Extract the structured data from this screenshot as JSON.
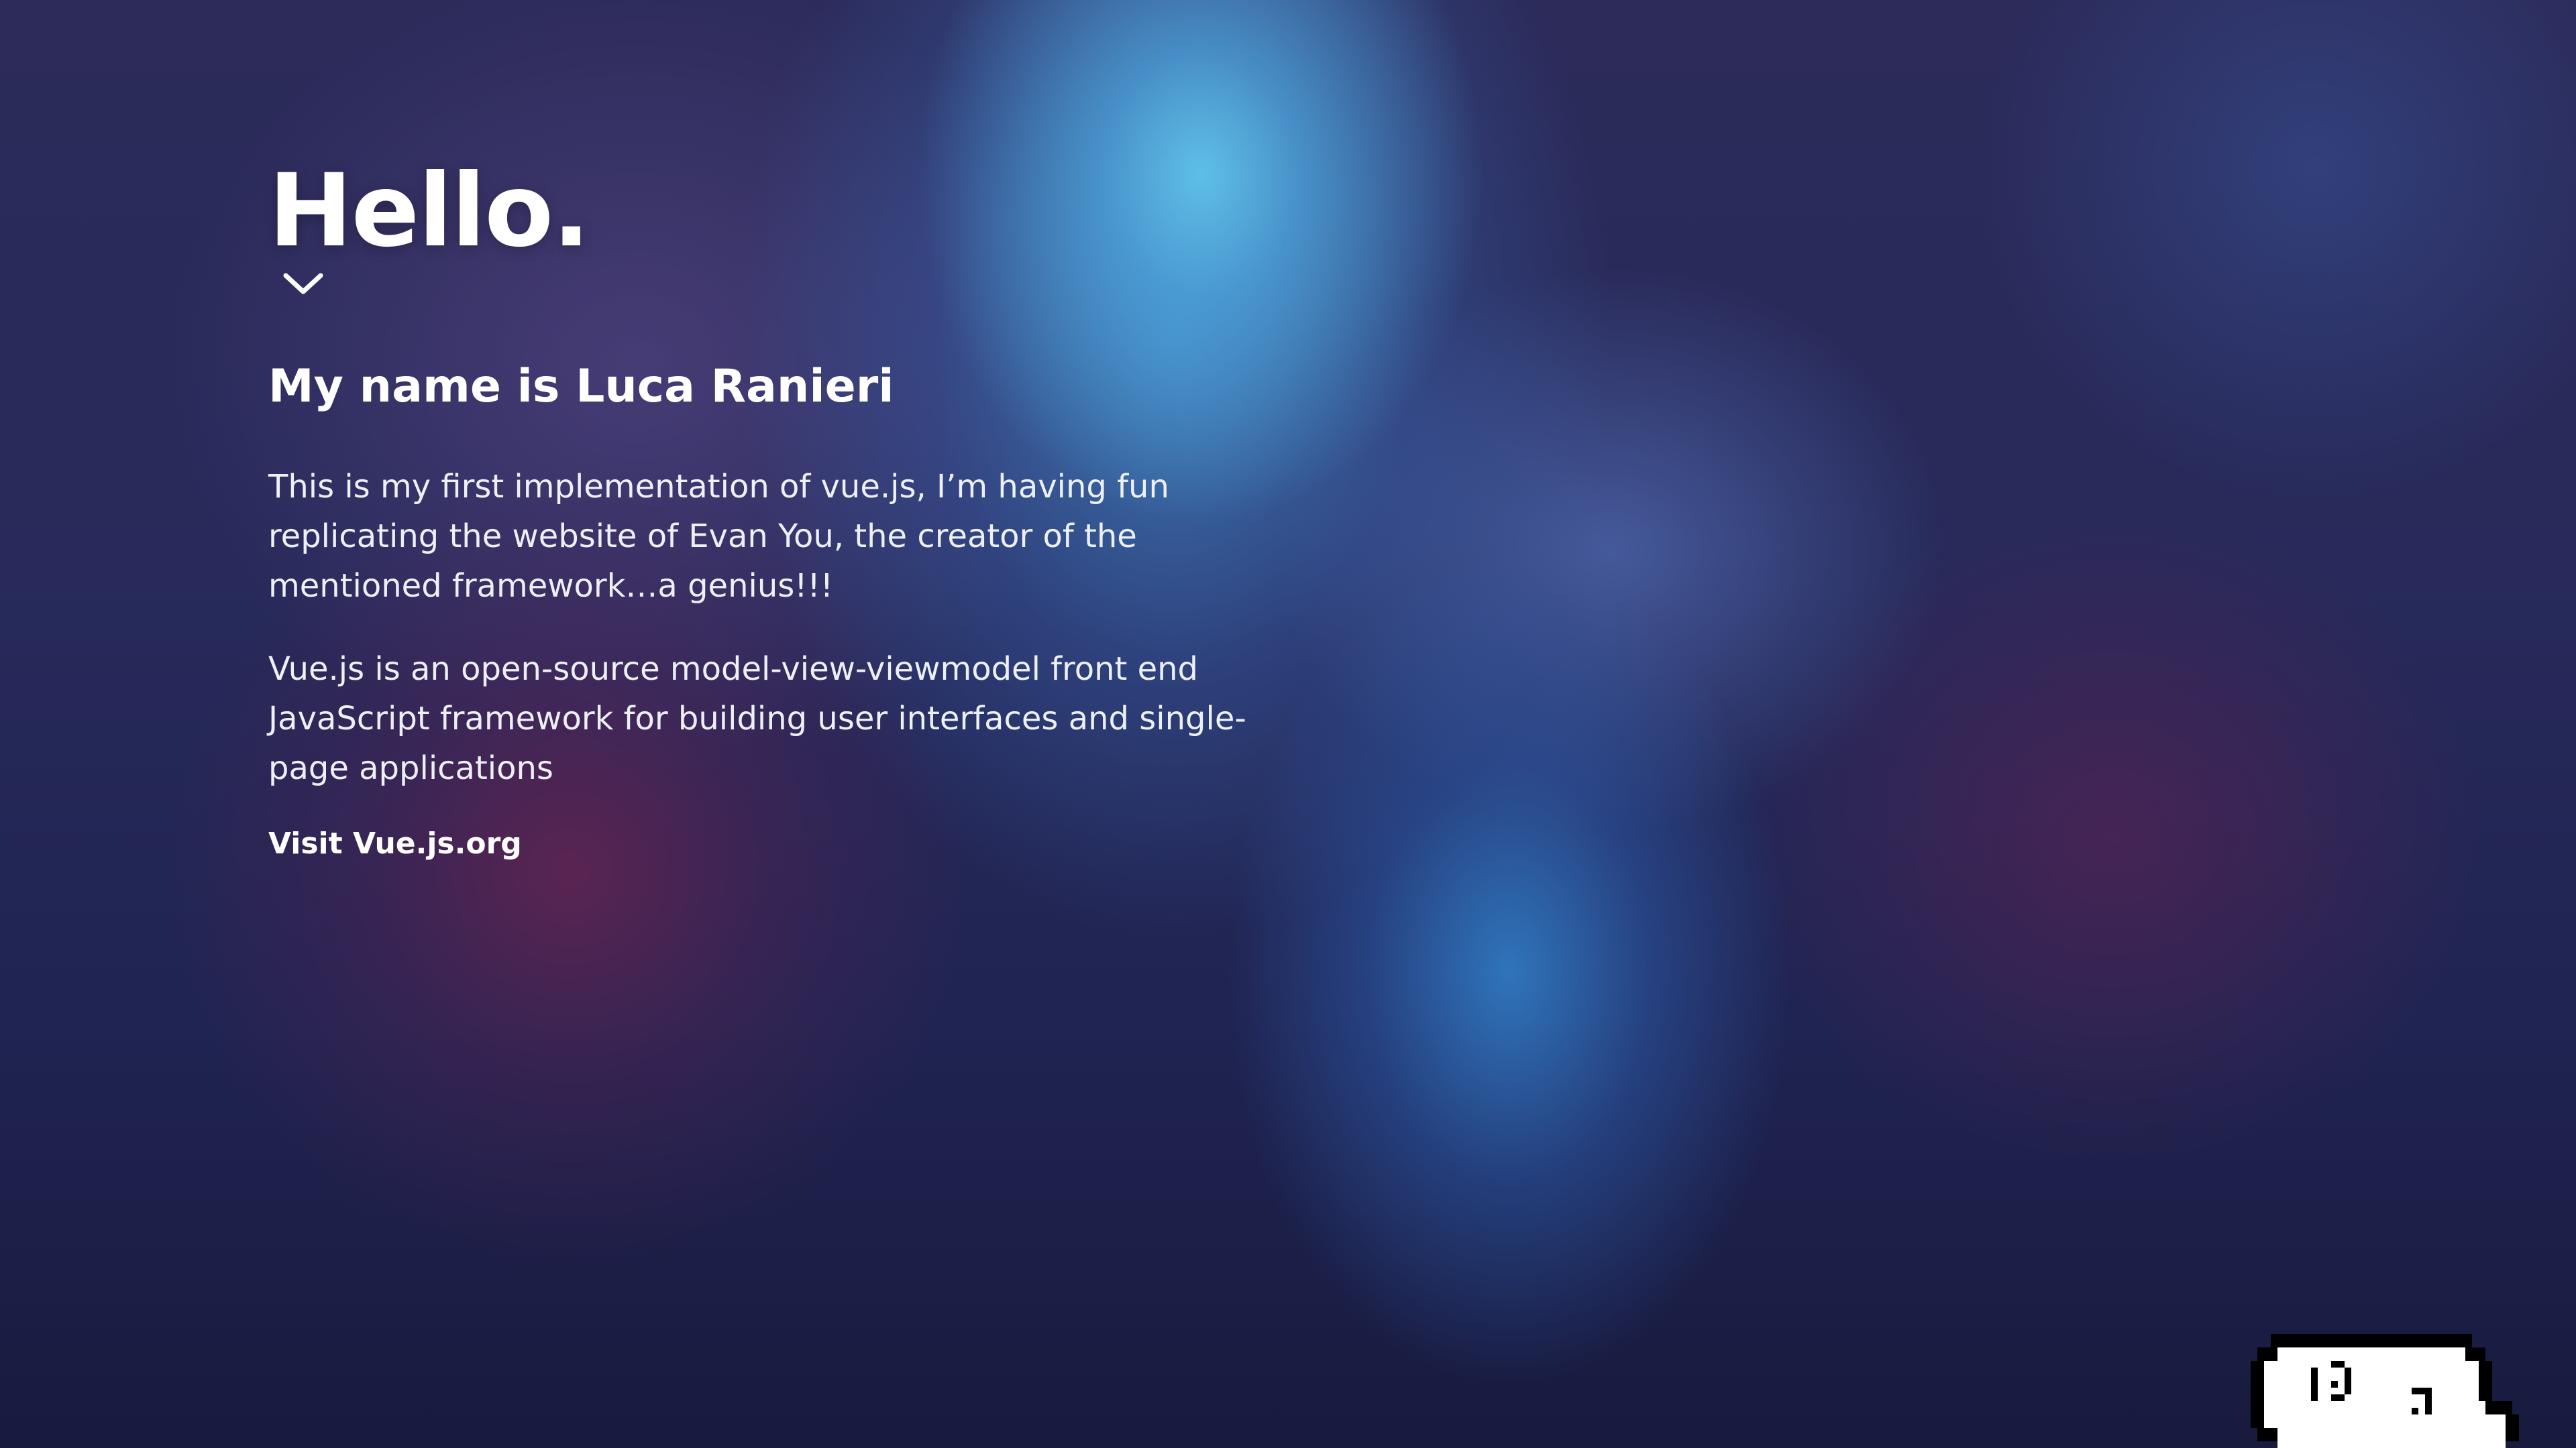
{
  "hero": {
    "greeting": "Hello.",
    "heading": "My name is Luca Ranieri",
    "paragraphs": [
      "This is my first implementation of vue.js, I’m having fun replicating the website of Evan You, the creator of the mentioned framework…a genius!!!",
      "Vue.js is an open-source model-view-viewmodel front end JavaScript framework for building user interfaces and single-page applications"
    ],
    "link_label": "Visit Vue.js.org"
  },
  "icons": {
    "scroll_indicator": "chevron-down-icon",
    "mascot": "pixel-ghost-icon"
  },
  "colors": {
    "text": "#ffffff",
    "background_dark": "#1d1c3e",
    "glow_blue": "#5fc4ea",
    "glow_magenta": "#6a2350"
  }
}
